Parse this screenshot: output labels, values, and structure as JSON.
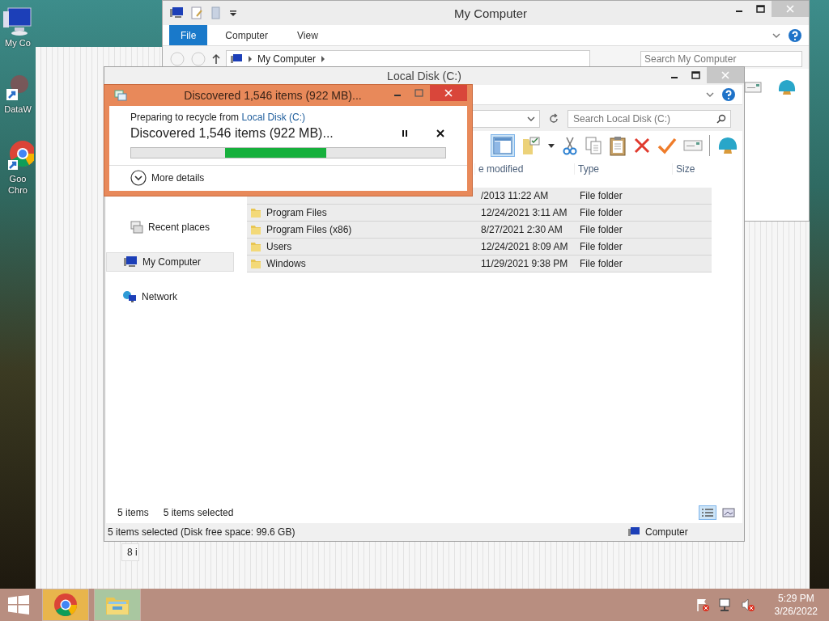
{
  "desktop_icons": [
    {
      "label": "My Co",
      "kind": "computer"
    },
    {
      "label": "DataW",
      "kind": "shortcut"
    },
    {
      "label": "Goo Chro",
      "kind": "chrome"
    }
  ],
  "back_window": {
    "title": "My Computer",
    "ribbon_tabs": [
      {
        "label": "File",
        "selected": true
      },
      {
        "label": "Computer",
        "selected": false
      },
      {
        "label": "View",
        "selected": false
      }
    ],
    "address": "My Computer",
    "search": {
      "placeholder": "Search My Computer"
    }
  },
  "explorer": {
    "title": "Local Disk (C:)",
    "search": {
      "placeholder": "Search Local Disk (C:)"
    },
    "columns": [
      "e modified",
      "Type",
      "Size"
    ],
    "rows": [
      {
        "date": "/2013 11:22 AM",
        "type": "File folder",
        "selected": true
      },
      {
        "name": "Program Files",
        "date": "12/24/2021 3:11 AM",
        "type": "File folder",
        "selected": true
      },
      {
        "name": "Program Files (x86)",
        "date": "8/27/2021 2:30 AM",
        "type": "File folder",
        "selected": true
      },
      {
        "name": "Users",
        "date": "12/24/2021 8:09 AM",
        "type": "File folder",
        "selected": true
      },
      {
        "name": "Windows",
        "date": "11/29/2021 9:38 PM",
        "type": "File folder",
        "selected": true
      }
    ],
    "sidebar": [
      {
        "label": "Recent places",
        "kind": "recent",
        "selected": false
      },
      {
        "label": "My Computer",
        "kind": "computer",
        "selected": true
      },
      {
        "label": "Network",
        "kind": "network",
        "selected": false
      }
    ],
    "item_count": "5 items",
    "selection_count": "5 items selected",
    "views": [
      {
        "kind": "details",
        "selected": true
      },
      {
        "kind": "tiles",
        "selected": false
      }
    ],
    "status_bar": {
      "text": "5 items selected (Disk free space: 99.6 GB)",
      "location": "Computer"
    }
  },
  "dialog": {
    "title": "Discovered 1,546 items (922 MB)...",
    "source_prefix": "Preparing to recycle from",
    "source_link": "Local Disk (C:)",
    "status": "Discovered 1,546 items (922 MB)...",
    "details_toggle": "More details"
  },
  "fragments": [
    "8 i"
  ],
  "taskbar": {
    "apps": [
      {
        "kind": "chrome"
      },
      {
        "kind": "explorer"
      }
    ],
    "time": "5:29 PM",
    "date": "3/26/2022"
  }
}
